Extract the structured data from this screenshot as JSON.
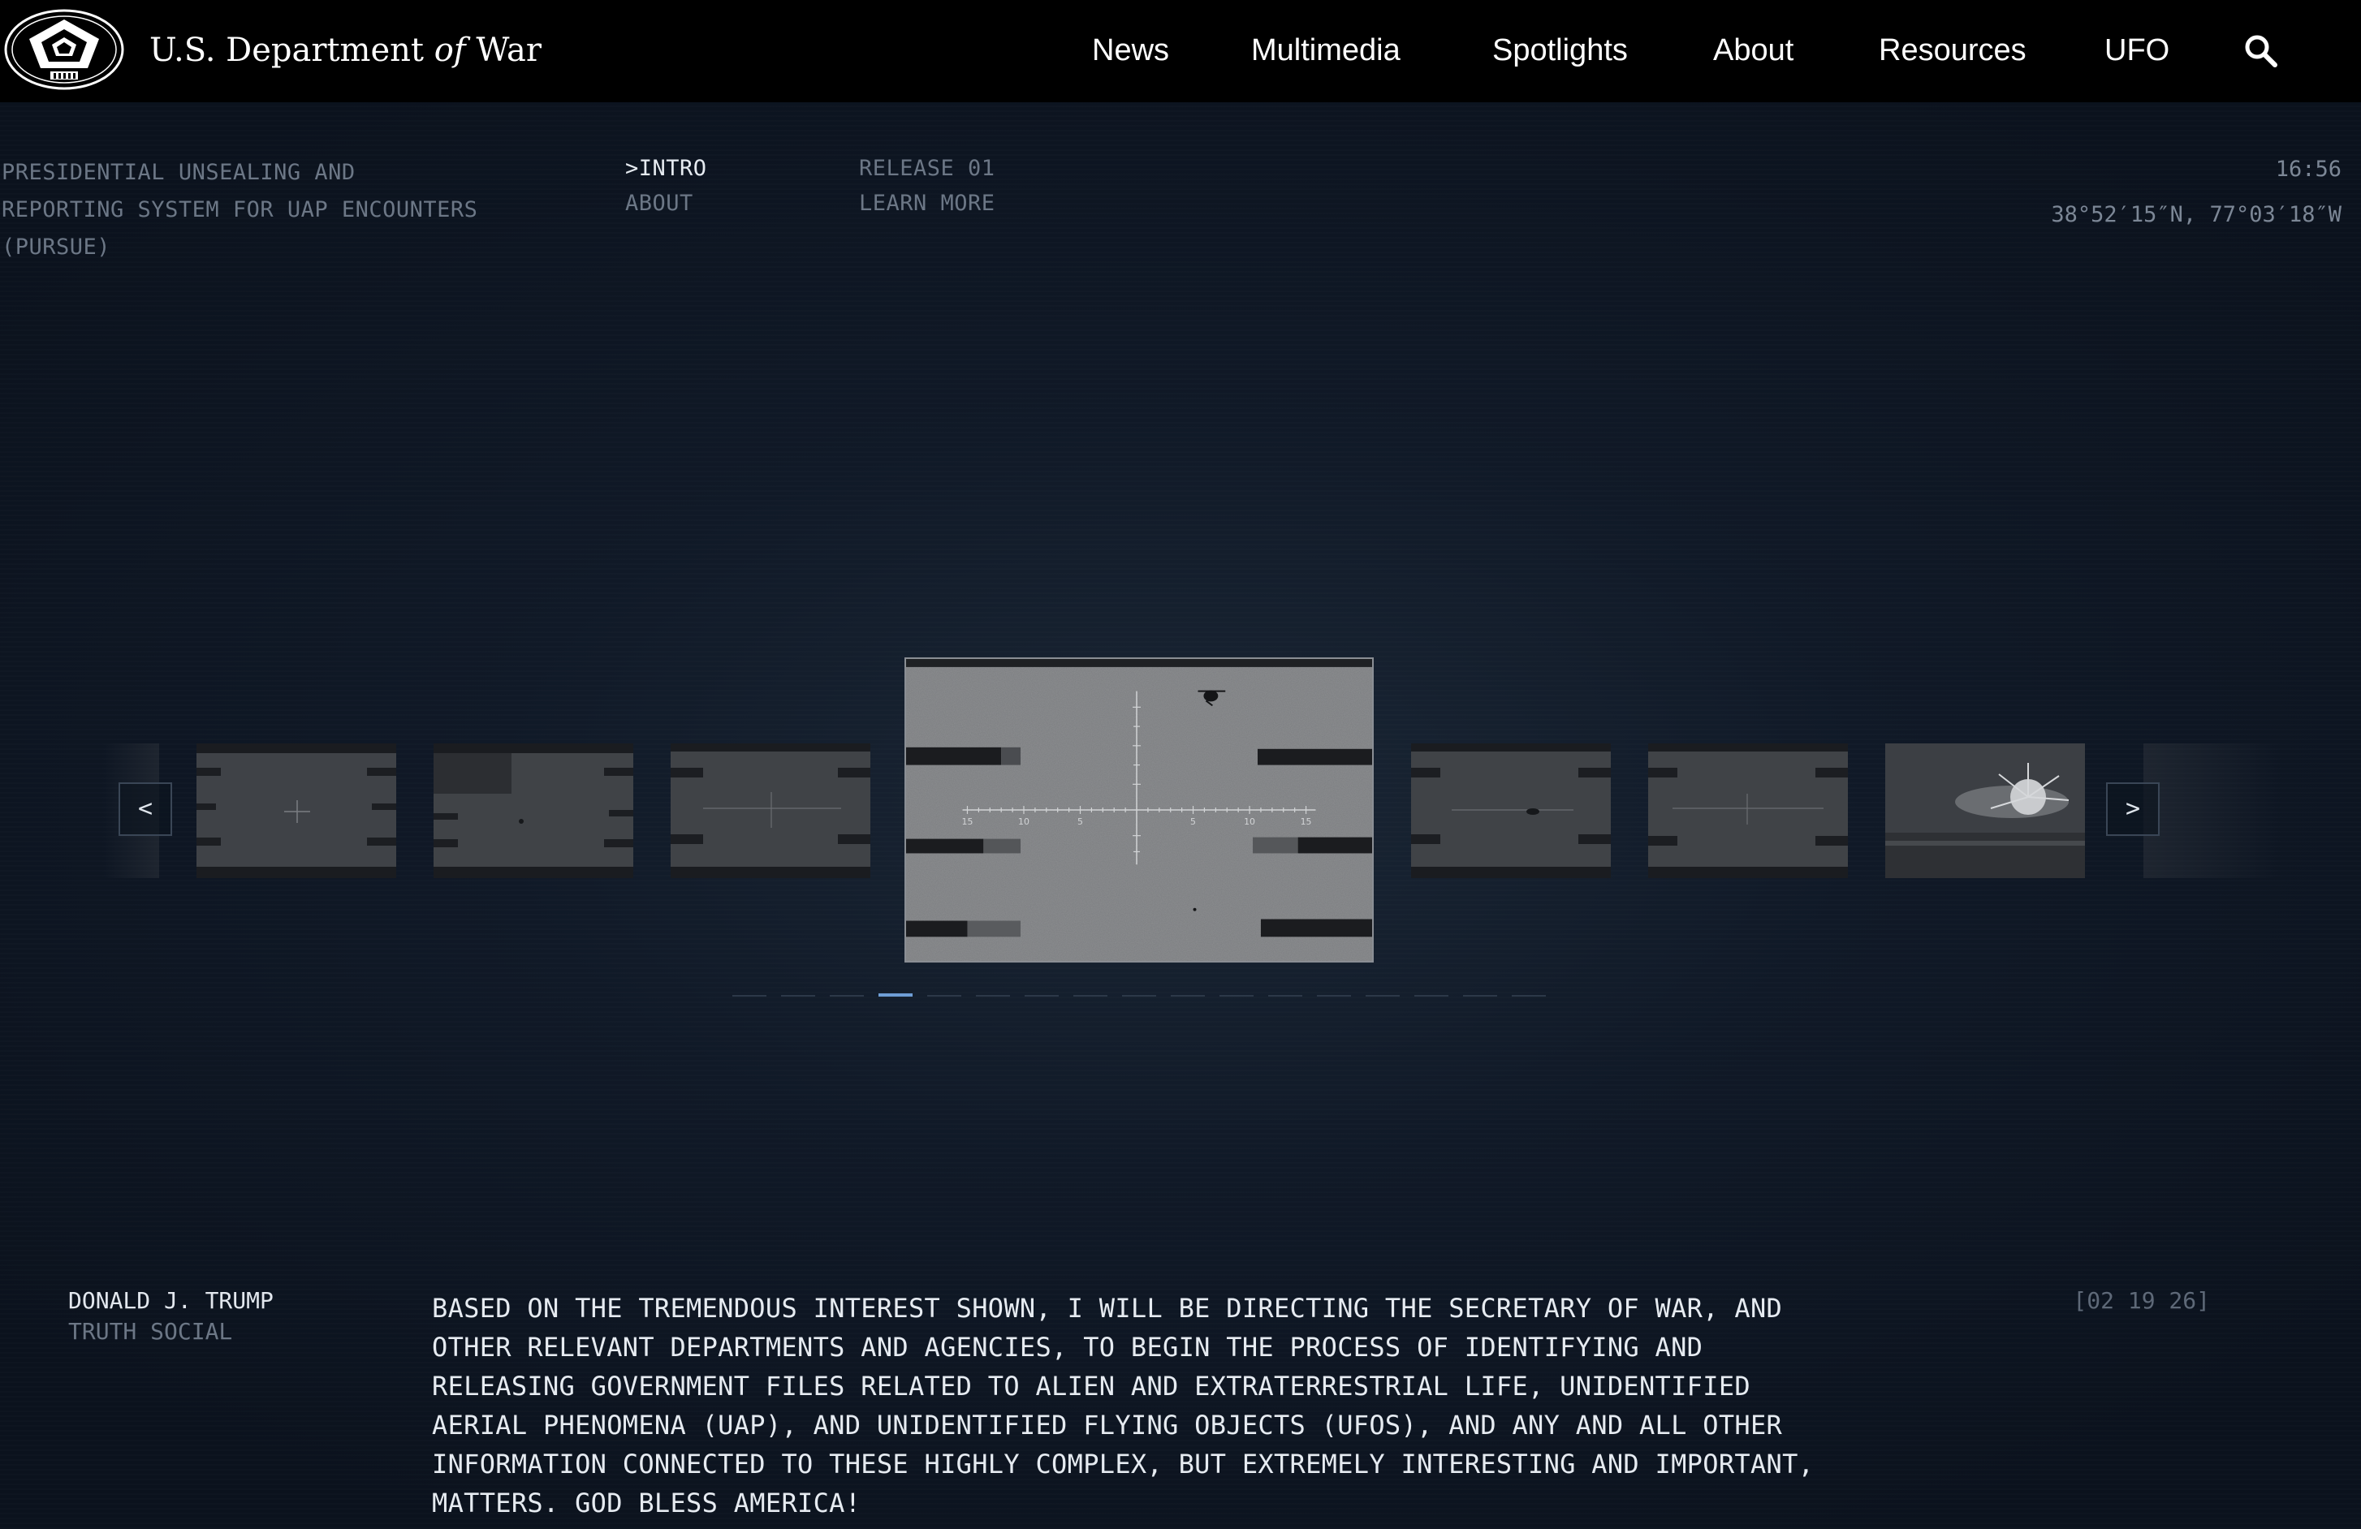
{
  "header": {
    "brand_pre": "U.S. Department",
    "brand_of": "of",
    "brand_post": "War",
    "nav": [
      "News",
      "Multimedia",
      "Spotlights",
      "About",
      "Resources",
      "UFO"
    ]
  },
  "hud": {
    "program_lines": [
      "PRESIDENTIAL UNSEALING AND",
      "REPORTING SYSTEM FOR UAP ENCOUNTERS",
      "(PURSUE)"
    ],
    "menu_active": ">INTRO",
    "menu_about": "ABOUT",
    "release": "RELEASE 01",
    "learn_more": "LEARN MORE",
    "time": "16:56",
    "coords": "38°52′15″N, 77°03′18″W"
  },
  "carousel": {
    "prev_label": "<",
    "next_label": ">",
    "slide_count": 17,
    "active_index": 3,
    "active_indicator_color": "#6f9ed6",
    "reticle_ticks": [
      "15",
      "10",
      "5",
      "5",
      "10",
      "15"
    ]
  },
  "quote": {
    "author": "DONALD J. TRUMP",
    "source": "TRUTH SOCIAL",
    "text": "BASED ON THE TREMENDOUS INTEREST SHOWN, I WILL BE DIRECTING THE SECRETARY OF WAR, AND OTHER RELEVANT DEPARTMENTS AND AGENCIES, TO BEGIN THE PROCESS OF IDENTIFYING AND RELEASING GOVERNMENT FILES RELATED TO ALIEN AND EXTRATERRESTRIAL LIFE, UNIDENTIFIED AERIAL PHENOMENA (UAP), AND UNIDENTIFIED FLYING OBJECTS (UFOS), AND ANY AND ALL OTHER INFORMATION CONNECTED TO THESE HIGHLY COMPLEX, BUT EXTREMELY INTERESTING AND IMPORTANT, MATTERS. GOD BLESS AMERICA!",
    "date": "[02 19 26]"
  },
  "icons": {
    "logo": "pentagon-seal-icon",
    "search": "search-icon"
  }
}
